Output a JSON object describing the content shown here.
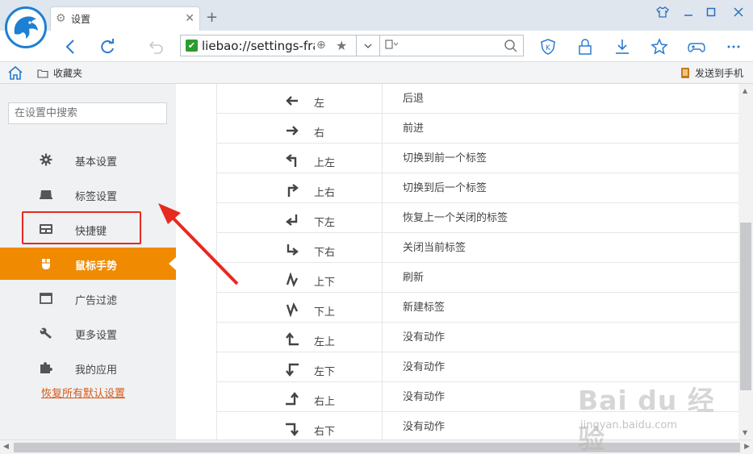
{
  "tab": {
    "title": "设置"
  },
  "toolbar": {
    "url": "liebao://settings-fra"
  },
  "bookmarks": {
    "favorites_label": "收藏夹",
    "send_to_phone_label": "发送到手机"
  },
  "sidebar": {
    "search_placeholder": "在设置中搜索",
    "items": [
      {
        "label": "基本设置",
        "icon": "gear-icon"
      },
      {
        "label": "标签设置",
        "icon": "tab-icon"
      },
      {
        "label": "快捷键",
        "icon": "keyboard-icon"
      },
      {
        "label": "鼠标手势",
        "icon": "mouse-icon",
        "active": true
      },
      {
        "label": "广告过滤",
        "icon": "window-icon"
      },
      {
        "label": "更多设置",
        "icon": "wrench-icon"
      },
      {
        "label": "我的应用",
        "icon": "puzzle-icon"
      }
    ],
    "reset_label": "恢复所有默认设置"
  },
  "gestures": [
    {
      "direction": "左",
      "action": "后退",
      "arrow": "left"
    },
    {
      "direction": "右",
      "action": "前进",
      "arrow": "right"
    },
    {
      "direction": "上左",
      "action": "切换到前一个标签",
      "arrow": "up-left"
    },
    {
      "direction": "上右",
      "action": "切换到后一个标签",
      "arrow": "up-right"
    },
    {
      "direction": "下左",
      "action": "恢复上一个关闭的标签",
      "arrow": "down-left"
    },
    {
      "direction": "下右",
      "action": "关闭当前标签",
      "arrow": "down-right"
    },
    {
      "direction": "上下",
      "action": "刷新",
      "arrow": "up-down"
    },
    {
      "direction": "下上",
      "action": "新建标签",
      "arrow": "down-up"
    },
    {
      "direction": "左上",
      "action": "没有动作",
      "arrow": "left-up"
    },
    {
      "direction": "左下",
      "action": "没有动作",
      "arrow": "left-down"
    },
    {
      "direction": "右上",
      "action": "没有动作",
      "arrow": "right-up"
    },
    {
      "direction": "右下",
      "action": "没有动作",
      "arrow": "right-down"
    }
  ],
  "watermark": {
    "brand": "Bai du 经验",
    "site": "jingyan.baidu.com"
  },
  "colors": {
    "accent": "#f08a00",
    "highlight_box": "#e8291f",
    "brand_blue": "#1e7fd3",
    "link": "#d55a1a"
  }
}
